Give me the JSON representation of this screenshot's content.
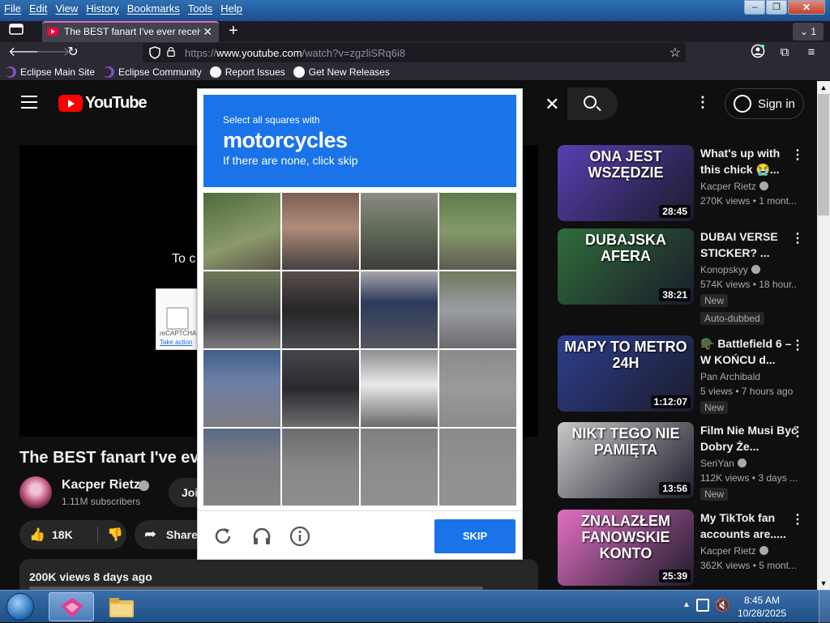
{
  "menubar": {
    "items": [
      "File",
      "Edit",
      "View",
      "History",
      "Bookmarks",
      "Tools",
      "Help"
    ]
  },
  "window_controls": {
    "minimize": "–",
    "maximize": "❐",
    "close": "✕"
  },
  "tabs": {
    "active_title": "The BEST fanart I've ever receive",
    "close": "✕",
    "new_tab": "+",
    "count": "1"
  },
  "navbar": {
    "url_scheme": "https://",
    "url_host": "www.youtube.com",
    "url_path": "/watch?v=zgzliSRq6i8"
  },
  "bookmarks": [
    {
      "label": "Eclipse Main Site",
      "icon": "eclipse-icon"
    },
    {
      "label": "Eclipse Community",
      "icon": "eclipse-icon"
    },
    {
      "label": "Report Issues",
      "icon": "github-icon"
    },
    {
      "label": "Get New Releases",
      "icon": "github-icon"
    }
  ],
  "youtube": {
    "logo": "YouTube",
    "sign_in": "Sign in",
    "player_text": "To c",
    "recaptcha_widget": {
      "label": "reCAPTCHA",
      "action": "Take action"
    },
    "video": {
      "title": "The BEST fanart I've eve",
      "channel": "Kacper Rietz",
      "subscribers": "1.11M subscribers",
      "join": "Joi",
      "likes": "18K",
      "share": "Share",
      "stats": "200K views  8 days ago"
    },
    "recommendations": [
      {
        "thumb_text": "ONA JEST WSZĘDZIE",
        "duration": "28:45",
        "title": "What's up with this chick 😭...",
        "channel": "Kacper Rietz",
        "verified": true,
        "meta": "270K views • 1 mont...",
        "badges": [],
        "thumb_color": "#5a3fb3"
      },
      {
        "thumb_text": "DUBAJSKA AFERA",
        "duration": "38:21",
        "title": "DUBAI VERSE STICKER? ...",
        "channel": "Konopskyy",
        "verified": true,
        "meta": "574K views • 18 hour...",
        "badges": [
          "New",
          "Auto-dubbed"
        ],
        "thumb_color": "#2f6d3a"
      },
      {
        "thumb_text": "MAPY TO METRO 24H",
        "duration": "1:12:07",
        "title": "🪖 Battlefield 6 – W KOŃCU d...",
        "channel": "Pan Archibald",
        "verified": false,
        "meta": "5 views • 7 hours ago",
        "badges": [
          "New"
        ],
        "thumb_color": "#2d3f8f"
      },
      {
        "thumb_text": "NIKT TEGO NIE PAMIĘTA",
        "duration": "13:56",
        "title": "Film Nie Musi Być Dobry Że...",
        "channel": "SeriYan",
        "verified": true,
        "meta": "112K views • 3 days ...",
        "badges": [
          "New"
        ],
        "thumb_color": "#c9c9c9"
      },
      {
        "thumb_text": "ZNALAZŁEM FANOWSKIE KONTO",
        "duration": "25:39",
        "title": "My TikTok fan accounts are.....",
        "channel": "Kacper Rietz",
        "verified": true,
        "meta": "362K views • 5 mont...",
        "badges": [],
        "thumb_color": "#e46fc4"
      }
    ]
  },
  "recaptcha_challenge": {
    "instruction": "Select all squares with",
    "target": "motorcycles",
    "hint": "If there are none, click skip",
    "skip": "SKIP",
    "icons": [
      "reload-icon",
      "headphones-icon",
      "info-icon"
    ],
    "accent": "#1a73e8"
  },
  "taskbar": {
    "time": "8:45 AM",
    "date": "10/28/2025"
  }
}
